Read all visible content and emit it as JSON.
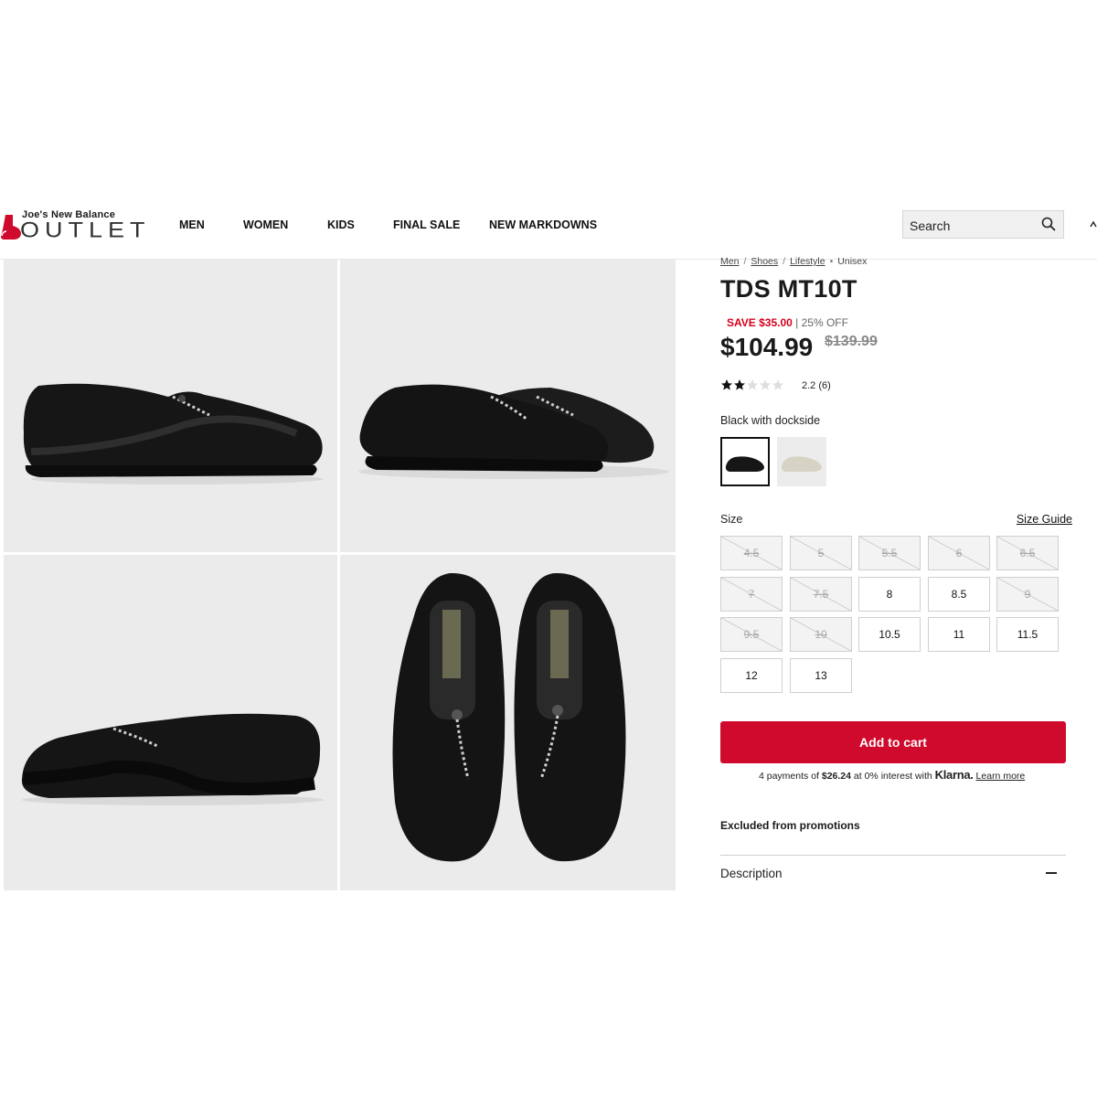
{
  "header": {
    "logo_top": "Joe's New Balance",
    "logo_main": "OUTLET",
    "nav": [
      "MEN",
      "WOMEN",
      "KIDS",
      "FINAL SALE",
      "NEW MARKDOWNS"
    ],
    "search_placeholder": "Search"
  },
  "breadcrumb": {
    "links": [
      "Men",
      "Shoes",
      "Lifestyle"
    ],
    "current": "Unisex"
  },
  "product": {
    "title": "TDS MT10T",
    "save": "SAVE $35.00",
    "discount": "| 25% OFF",
    "price": "$104.99",
    "original_price": "$139.99",
    "rating_value": 2.2,
    "rating_text": "2.2 (6)",
    "color_name": "Black with dockside",
    "swatches": [
      {
        "name": "Black with dockside",
        "selected": true
      },
      {
        "name": "Light",
        "selected": false
      }
    ]
  },
  "sizes": {
    "label": "Size",
    "guide": "Size Guide",
    "options": [
      {
        "size": "4.5",
        "available": false
      },
      {
        "size": "5",
        "available": false
      },
      {
        "size": "5.5",
        "available": false
      },
      {
        "size": "6",
        "available": false
      },
      {
        "size": "6.5",
        "available": false
      },
      {
        "size": "7",
        "available": false
      },
      {
        "size": "7.5",
        "available": false
      },
      {
        "size": "8",
        "available": true
      },
      {
        "size": "8.5",
        "available": true
      },
      {
        "size": "9",
        "available": false
      },
      {
        "size": "9.5",
        "available": false
      },
      {
        "size": "10",
        "available": false
      },
      {
        "size": "10.5",
        "available": true
      },
      {
        "size": "11",
        "available": true
      },
      {
        "size": "11.5",
        "available": true
      },
      {
        "size": "12",
        "available": true
      },
      {
        "size": "13",
        "available": true
      }
    ]
  },
  "cart": {
    "button": "Add to cart",
    "klarna_pre": "4 payments of",
    "klarna_amount": "$26.24",
    "klarna_mid": "at 0% interest with",
    "klarna_brand": "Klarna.",
    "klarna_link": "Learn more"
  },
  "promo_note": "Excluded from promotions",
  "description_label": "Description",
  "colors": {
    "accent": "#cf0a2c",
    "sale": "#d6001c"
  }
}
